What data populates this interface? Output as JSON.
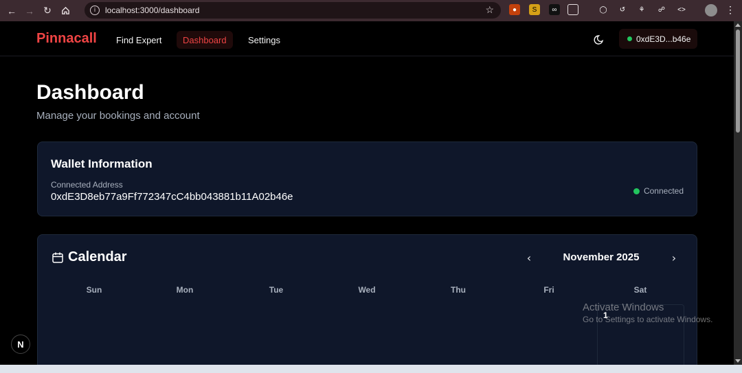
{
  "browser": {
    "url": "localhost:3000/dashboard",
    "extensions": [
      "fox-icon",
      "s-icon",
      "loop-icon",
      "puzzle-icon",
      "key-icon",
      "history-icon",
      "bug-icon",
      "link-icon",
      "code-icon"
    ]
  },
  "nav": {
    "brand": "Pinnacall",
    "links": [
      "Find Expert",
      "Dashboard",
      "Settings"
    ],
    "wallet_short": "0xdE3D...b46e"
  },
  "header": {
    "title": "Dashboard",
    "subtitle": "Manage your bookings and account"
  },
  "wallet": {
    "heading": "Wallet Information",
    "address_label": "Connected Address",
    "address": "0xdE3D8eb77a9Ff772347cC4bb043881b11A02b46e",
    "status": "Connected"
  },
  "calendar": {
    "heading": "Calendar",
    "month": "November 2025",
    "weekdays": [
      "Sun",
      "Mon",
      "Tue",
      "Wed",
      "Thu",
      "Fri",
      "Sat"
    ],
    "first_day": "1"
  },
  "overlay": {
    "watermark_title": "Activate Windows",
    "watermark_sub": "Go to Settings to activate Windows.",
    "badge": "N"
  },
  "colors": {
    "accent": "#ef4444",
    "status_green": "#22c55e",
    "card_bg": "#0f172a"
  }
}
